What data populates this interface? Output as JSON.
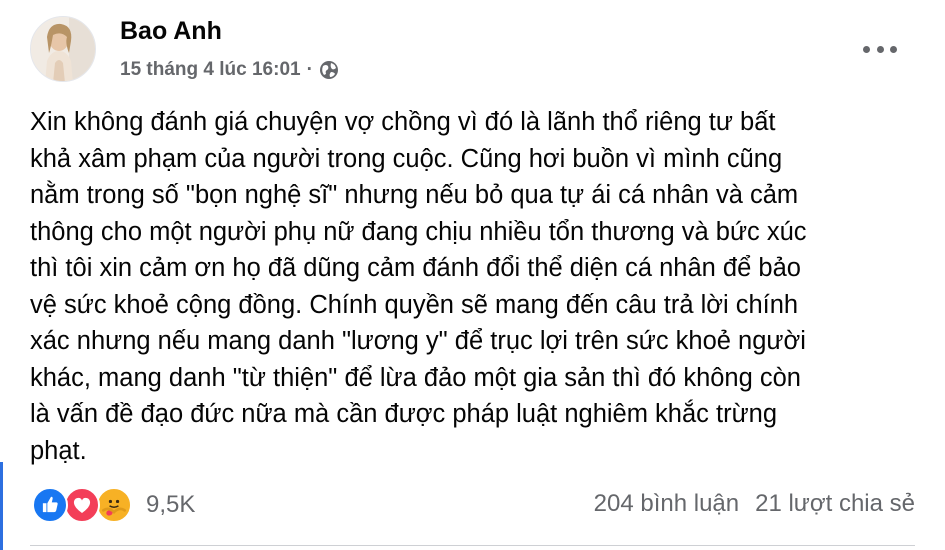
{
  "post": {
    "author": "Bao Anh",
    "timestamp": "15 tháng 4 lúc 16:01",
    "separator": "·",
    "privacy_icon": "globe-icon",
    "more_icon": "more-horizontal-icon",
    "text": "Xin không đánh giá chuyện vợ chồng vì đó là lãnh thổ riêng tư bất\nkhả xâm phạm của người trong cuộc. Cũng hơi buồn vì mình cũng\nnằm trong số \"bọn nghệ sĩ\" nhưng nếu bỏ qua tự ái cá nhân và cảm\nthông cho một người phụ nữ đang chịu nhiều tổn thương và bức xúc\nthì tôi xin cảm ơn họ đã dũng cảm đánh đổi thể diện cá nhân để bảo\nvệ sức khoẻ cộng đồng. Chính quyền sẽ mang đến câu trả lời chính\nxác nhưng nếu mang danh \"lương y\" để trục lợi trên sức khoẻ người\nkhác, mang danh \"từ thiện\" để lừa đảo một gia sản thì đó không còn\nlà vấn đề đạo đức nữa mà cần được pháp luật nghiêm khắc trừng\nphạt."
  },
  "engagement": {
    "reaction_icons": [
      "like-icon",
      "love-icon",
      "care-icon"
    ],
    "reaction_count": "9,5K",
    "comments": "204 bình luận",
    "shares": "21 lượt chia sẻ"
  },
  "colors": {
    "like": "#1877f2",
    "love": "#f33e58",
    "care": "#f7b125",
    "secondary_text": "#65676b",
    "primary_text": "#050505",
    "accent_bar": "#2d6fe0"
  }
}
